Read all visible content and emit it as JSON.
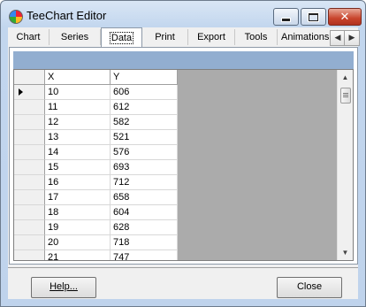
{
  "window": {
    "title": "TeeChart Editor"
  },
  "titlebar_buttons": {
    "minimize_icon": "minimize-icon",
    "maximize_icon": "maximize-icon",
    "close_glyph": "✕"
  },
  "tabs": [
    {
      "label": "Chart",
      "active": false
    },
    {
      "label": "Series",
      "active": false
    },
    {
      "label": "Data",
      "active": true
    },
    {
      "label": "Print",
      "active": false
    },
    {
      "label": "Export",
      "active": false
    },
    {
      "label": "Tools",
      "active": false
    },
    {
      "label": "Animations",
      "active": false
    }
  ],
  "tab_nav": {
    "prev": "◀",
    "next": "▶"
  },
  "grid": {
    "columns": [
      "X",
      "Y"
    ],
    "current_row": 0,
    "rows": [
      [
        "10",
        "606"
      ],
      [
        "11",
        "612"
      ],
      [
        "12",
        "582"
      ],
      [
        "13",
        "521"
      ],
      [
        "14",
        "576"
      ],
      [
        "15",
        "693"
      ],
      [
        "16",
        "712"
      ],
      [
        "17",
        "658"
      ],
      [
        "18",
        "604"
      ],
      [
        "19",
        "628"
      ],
      [
        "20",
        "718"
      ],
      [
        "21",
        "747"
      ]
    ]
  },
  "scrollbar": {
    "up": "▲",
    "down": "▼"
  },
  "buttons": {
    "help": "Help...",
    "close": "Close"
  },
  "colors": {
    "header_band": "#92aed0",
    "grid_background": "#ababab"
  }
}
